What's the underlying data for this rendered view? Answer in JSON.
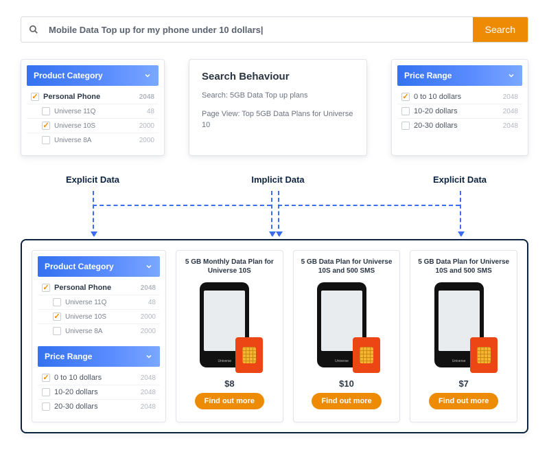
{
  "search": {
    "placeholder": "Mobile Data Top up for my phone under 10 dollars|",
    "button": "Search"
  },
  "top": {
    "category": {
      "title": "Product Category",
      "parent": {
        "label": "Personal Phone",
        "count": "2048",
        "checked": true
      },
      "children": [
        {
          "label": "Universe 11Q",
          "count": "48",
          "checked": false
        },
        {
          "label": "Universe 10S",
          "count": "2000",
          "checked": true
        },
        {
          "label": "Universe 8A",
          "count": "2000",
          "checked": false
        }
      ]
    },
    "behaviour": {
      "title": "Search Behaviour",
      "line1": "Search: 5GB Data Top up plans",
      "line2": "Page View: Top 5GB Data Plans for Universe 10"
    },
    "price": {
      "title": "Price Range",
      "items": [
        {
          "label": "0 to 10 dollars",
          "count": "2048",
          "checked": true
        },
        {
          "label": "10-20 dollars",
          "count": "2048",
          "checked": false
        },
        {
          "label": "20-30 dollars",
          "count": "2048",
          "checked": false
        }
      ]
    }
  },
  "captions": {
    "left": "Explicit Data",
    "center": "Implicit Data",
    "right": "Explicit Data"
  },
  "results": {
    "sidebar": {
      "category": {
        "title": "Product Category",
        "parent": {
          "label": "Personal Phone",
          "count": "2048",
          "checked": true
        },
        "children": [
          {
            "label": "Universe 11Q",
            "count": "48",
            "checked": false
          },
          {
            "label": "Universe 10S",
            "count": "2000",
            "checked": true
          },
          {
            "label": "Universe 8A",
            "count": "2000",
            "checked": false
          }
        ]
      },
      "price": {
        "title": "Price Range",
        "items": [
          {
            "label": "0 to 10 dollars",
            "count": "2048",
            "checked": true
          },
          {
            "label": "10-20 dollars",
            "count": "2048",
            "checked": false
          },
          {
            "label": "20-30 dollars",
            "count": "2048",
            "checked": false
          }
        ]
      }
    },
    "products": [
      {
        "title": "5 GB Monthly Data Plan for Universe 10S",
        "brand": "Universe",
        "price": "$8",
        "cta": "Find out more"
      },
      {
        "title": "5 GB Data Plan for Universe 10S and 500 SMS",
        "brand": "Universe",
        "price": "$10",
        "cta": "Find out more"
      },
      {
        "title": "5 GB Data Plan for Universe 10S and 500 SMS",
        "brand": "Universe",
        "price": "$7",
        "cta": "Find out more"
      }
    ]
  }
}
